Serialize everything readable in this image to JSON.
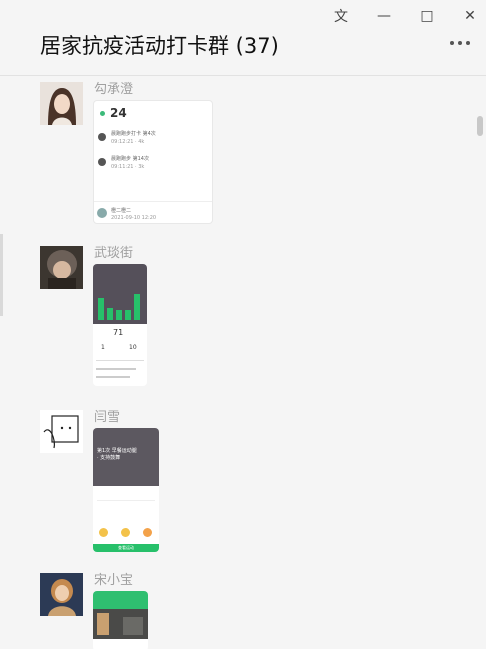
{
  "window": {
    "controls": {
      "pin": "⽂",
      "minimize": "—",
      "maximize": "□",
      "close": "✕"
    }
  },
  "chat": {
    "title": "居家抗疫活动打卡群 (37)"
  },
  "messages": [
    {
      "sender": "勾承澄",
      "card": {
        "number": "24",
        "items": [
          {
            "title": "晨跑跑步打卡 第4次",
            "sub": "09:12:21 · 4k"
          },
          {
            "title": "晨跑跑步 第14次",
            "sub": "09:11:21 · 3k"
          }
        ],
        "footer_name": "橙二橙二",
        "footer_sub": "2021-09-10 12:20"
      }
    },
    {
      "sender": "武琰街",
      "card": {
        "stat_a": "71",
        "stat_b": "1",
        "stat_c": "10"
      }
    },
    {
      "sender": "闫雪",
      "card": {
        "headline": "第1次 早餐运动腿 · 支持鼓舞",
        "btn": "查看运动"
      }
    },
    {
      "sender": "宋小宝",
      "card": {}
    }
  ]
}
